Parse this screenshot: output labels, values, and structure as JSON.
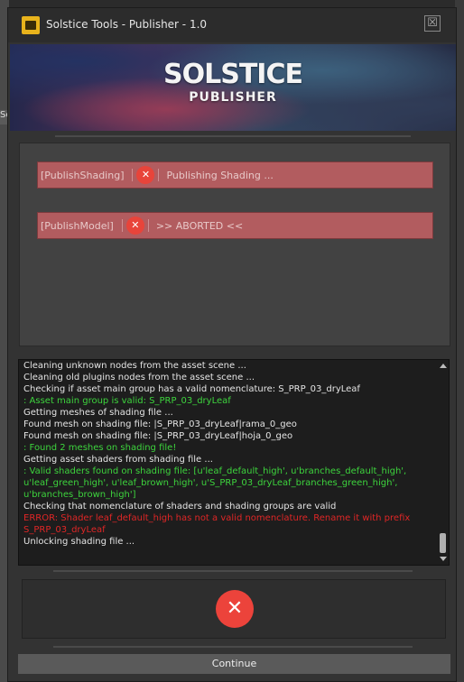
{
  "window": {
    "title": "Solstice Tools - Publisher - 1.0",
    "close_glyph": "☒"
  },
  "banner": {
    "logo_main": "SOLSTICE",
    "logo_sub": "PUBLISHER"
  },
  "background": {
    "tab_text": "Sc"
  },
  "steps": [
    {
      "name": "[PublishShading]",
      "status_icon": "x-circle-icon",
      "message": "Publishing Shading ..."
    },
    {
      "name": "[PublishModel]",
      "status_icon": "x-circle-icon",
      "message": ">> ABORTED <<"
    }
  ],
  "log": [
    {
      "text": "Cleaning unknown nodes from the asset scene ...",
      "level": "normal"
    },
    {
      "text": "Cleaning old plugins nodes from the asset scene ...",
      "level": "normal"
    },
    {
      "text": "Checking if asset main group has a valid nomenclature: S_PRP_03_dryLeaf",
      "level": "normal"
    },
    {
      "text": ": Asset main group is valid: S_PRP_03_dryLeaf",
      "level": "success"
    },
    {
      "text": "Getting meshes of shading file ...",
      "level": "normal"
    },
    {
      "text": "Found mesh on shading file: |S_PRP_03_dryLeaf|rama_0_geo",
      "level": "normal"
    },
    {
      "text": "Found mesh on shading file: |S_PRP_03_dryLeaf|hoja_0_geo",
      "level": "normal"
    },
    {
      "text": ": Found 2 meshes on shading file!",
      "level": "success"
    },
    {
      "text": "Getting asset shaders from shading file ...",
      "level": "normal"
    },
    {
      "text": ": Valid shaders found on shading file: [u'leaf_default_high', u'branches_default_high', u'leaf_green_high', u'leaf_brown_high', u'S_PRP_03_dryLeaf_branches_green_high', u'branches_brown_high']",
      "level": "success"
    },
    {
      "text": "Checking that nomenclature of shaders and shading groups are valid",
      "level": "normal"
    },
    {
      "text": "ERROR: Shader leaf_default_high has not a valid nomenclature. Rename it with prefix S_PRP_03_dryLeaf",
      "level": "error"
    },
    {
      "text": "Unlocking shading file ...",
      "level": "normal"
    }
  ],
  "result": {
    "icon": "x-circle-icon",
    "glyph": "✕"
  },
  "continue_label": "Continue",
  "colors": {
    "step_failed_bg": "#b25c5f",
    "error_icon": "#e8443a",
    "log_success": "#3dd43d",
    "log_error": "#e02626"
  }
}
